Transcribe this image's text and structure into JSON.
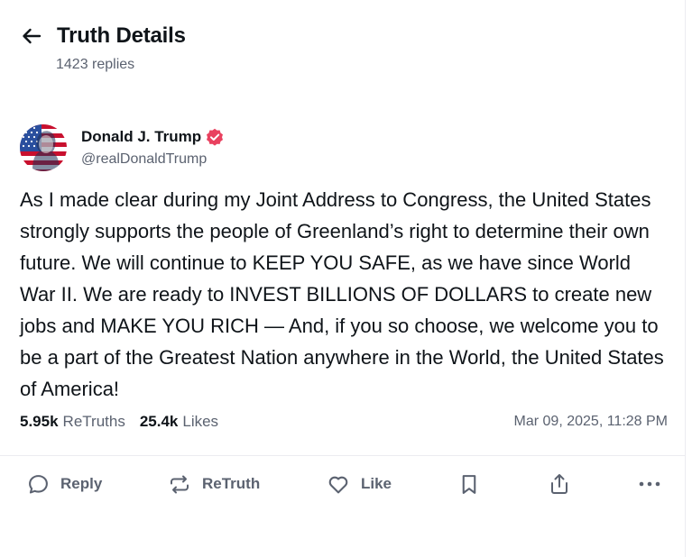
{
  "header": {
    "title": "Truth Details",
    "replies": "1423 replies"
  },
  "post": {
    "author_name": "Donald J. Trump",
    "author_handle": "@realDonaldTrump",
    "body": "As I made clear during my Joint Address to Congress, the United States strongly supports the people of Greenland’s right to determine their own future. We will continue to KEEP YOU SAFE, as we have since World War II. We are ready to INVEST BILLIONS OF DOLLARS to create new jobs and MAKE YOU RICH — And, if you so choose, we welcome you to be a part of the Greatest Nation anywhere in the World, the United States of America!",
    "retruths_count": "5.95k",
    "retruths_label": "ReTruths",
    "likes_count": "25.4k",
    "likes_label": "Likes",
    "timestamp": "Mar 09, 2025, 11:28 PM"
  },
  "actions": {
    "reply": "Reply",
    "retruth": "ReTruth",
    "like": "Like"
  },
  "icons": {
    "back": "arrow-left-icon",
    "verified": "verified-badge-icon",
    "reply": "speech-bubble-icon",
    "retruth": "repost-arrows-icon",
    "like": "heart-icon",
    "bookmark": "bookmark-icon",
    "share": "share-upload-icon",
    "more": "more-dots-icon"
  },
  "colors": {
    "verified": "#e9415f",
    "text": "#0f1419",
    "muted": "#5b6270",
    "divider": "#ececf0"
  }
}
